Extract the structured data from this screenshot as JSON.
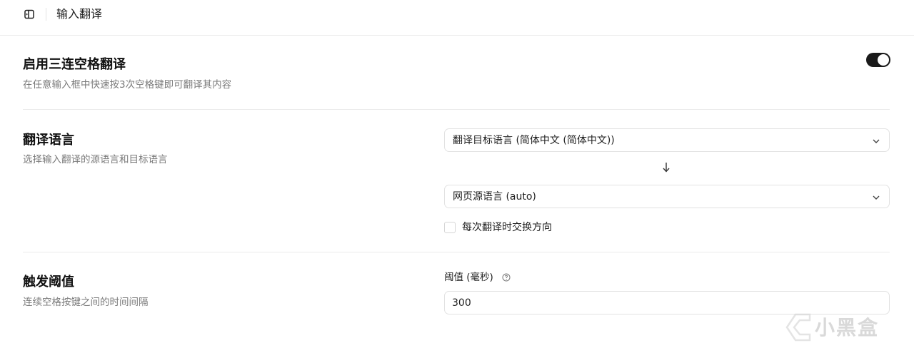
{
  "header": {
    "sidebar_toggle_icon": "sidebar-toggle-icon",
    "title": "输入翻译"
  },
  "enable_section": {
    "title": "启用三连空格翻译",
    "description": "在任意输入框中快速按3次空格键即可翻译其内容",
    "toggle_on": true
  },
  "language_section": {
    "title": "翻译语言",
    "description": "选择输入翻译的源语言和目标语言",
    "target_select_value": "翻译目标语言 (简体中文 (简体中文))",
    "arrow_icon": "arrow-down-icon",
    "source_select_value": "网页源语言 (auto)",
    "swap_checkbox_label": "每次翻译时交换方向",
    "swap_checked": false
  },
  "threshold_section": {
    "title": "触发阈值",
    "description": "连续空格按键之间的时间间隔",
    "field_label": "阈值 (毫秒)",
    "help_icon": "help-circle-icon",
    "value": "300"
  },
  "watermark": {
    "text": "小黑盒"
  },
  "colors": {
    "toggle_on": "#1a1a1a",
    "border": "#e2e2e2",
    "muted_text": "#7a7a7a"
  }
}
